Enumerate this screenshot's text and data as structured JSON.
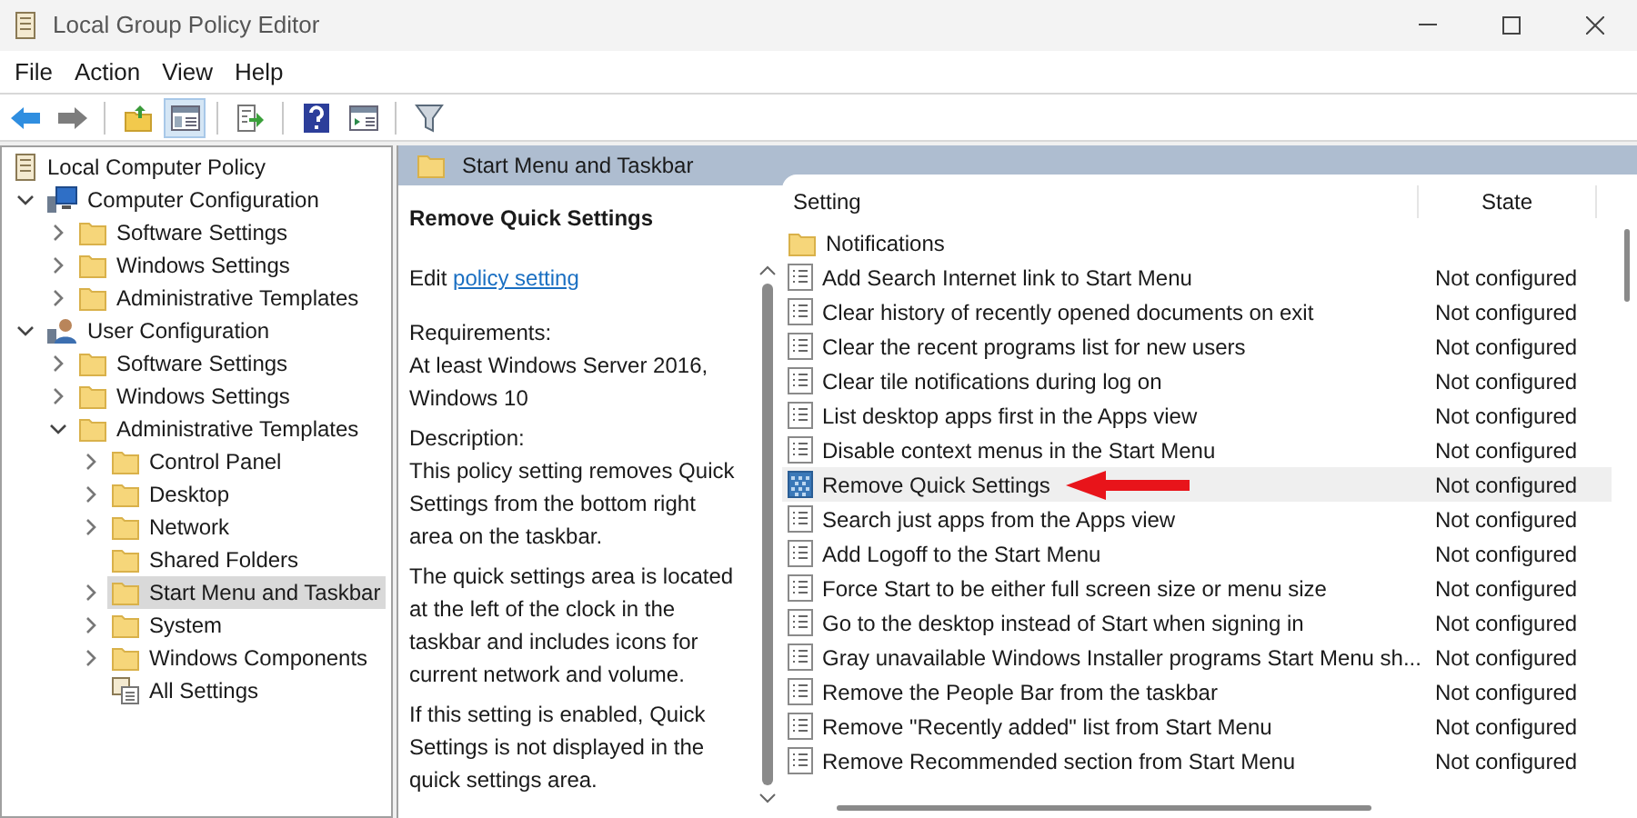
{
  "window": {
    "title": "Local Group Policy Editor"
  },
  "menu": [
    "File",
    "Action",
    "View",
    "Help"
  ],
  "toolbar": [
    {
      "kind": "back",
      "selected": false
    },
    {
      "kind": "forward",
      "selected": false
    },
    {
      "kind": "sep"
    },
    {
      "kind": "up",
      "selected": false
    },
    {
      "kind": "tree",
      "selected": true
    },
    {
      "kind": "sep"
    },
    {
      "kind": "export",
      "selected": false
    },
    {
      "kind": "sep"
    },
    {
      "kind": "help",
      "selected": false
    },
    {
      "kind": "view",
      "selected": false
    },
    {
      "kind": "sep"
    },
    {
      "kind": "filter",
      "selected": false
    }
  ],
  "tree": [
    {
      "label": "Local Computer Policy",
      "kind": "policy",
      "selected": false,
      "children": [
        {
          "label": "Computer Configuration",
          "kind": "computer",
          "expanded": true,
          "selected": false,
          "children": [
            {
              "label": "Software Settings",
              "kind": "folder",
              "expanded": false,
              "selected": false
            },
            {
              "label": "Windows Settings",
              "kind": "folder",
              "expanded": false,
              "selected": false
            },
            {
              "label": "Administrative Templates",
              "kind": "folder",
              "expanded": false,
              "selected": false
            }
          ]
        },
        {
          "label": "User Configuration",
          "kind": "user",
          "expanded": true,
          "selected": false,
          "children": [
            {
              "label": "Software Settings",
              "kind": "folder",
              "expanded": false,
              "selected": false
            },
            {
              "label": "Windows Settings",
              "kind": "folder",
              "expanded": false,
              "selected": false
            },
            {
              "label": "Administrative Templates",
              "kind": "folder",
              "expanded": true,
              "selected": false,
              "children": [
                {
                  "label": "Control Panel",
                  "kind": "folder",
                  "expanded": false,
                  "selected": false
                },
                {
                  "label": "Desktop",
                  "kind": "folder",
                  "expanded": false,
                  "selected": false
                },
                {
                  "label": "Network",
                  "kind": "folder",
                  "expanded": false,
                  "selected": false
                },
                {
                  "label": "Shared Folders",
                  "kind": "folder",
                  "selected": false
                },
                {
                  "label": "Start Menu and Taskbar",
                  "kind": "folder",
                  "expanded": false,
                  "selected": true
                },
                {
                  "label": "System",
                  "kind": "folder",
                  "expanded": false,
                  "selected": false
                },
                {
                  "label": "Windows Components",
                  "kind": "folder",
                  "expanded": false,
                  "selected": false
                },
                {
                  "label": "All Settings",
                  "kind": "all",
                  "selected": false
                }
              ]
            }
          ]
        }
      ]
    }
  ],
  "header": {
    "title": "Start Menu and Taskbar"
  },
  "description": {
    "title": "Remove Quick Settings",
    "edit_prefix": "Edit",
    "edit_link": "policy setting",
    "requirements_label": "Requirements:",
    "requirements": "At least Windows Server 2016, Windows 10",
    "description_label": "Description:",
    "paragraphs": [
      "This policy setting removes Quick Settings from the bottom right area on the taskbar.",
      "The quick settings area is located at the left of the clock in the taskbar and includes icons for current network and volume.",
      "If this setting is enabled, Quick Settings is not displayed in the quick settings area."
    ]
  },
  "table": {
    "columns": [
      "Setting",
      "State"
    ],
    "rows": [
      {
        "kind": "folder",
        "setting": "Notifications",
        "selected": false
      },
      {
        "kind": "policy",
        "setting": "Add Search Internet link to Start Menu",
        "state": "Not configured",
        "selected": false
      },
      {
        "kind": "policy",
        "setting": "Clear history of recently opened documents on exit",
        "state": "Not configured",
        "selected": false
      },
      {
        "kind": "policy",
        "setting": "Clear the recent programs list for new users",
        "state": "Not configured",
        "selected": false
      },
      {
        "kind": "policy",
        "setting": "Clear tile notifications during log on",
        "state": "Not configured",
        "selected": false
      },
      {
        "kind": "policy",
        "setting": "List desktop apps first in the Apps view",
        "state": "Not configured",
        "selected": false
      },
      {
        "kind": "policy",
        "setting": "Disable context menus in the Start Menu",
        "state": "Not configured",
        "selected": false
      },
      {
        "kind": "policy",
        "setting": "Remove Quick Settings",
        "state": "Not configured",
        "selected": true
      },
      {
        "kind": "policy",
        "setting": "Search just apps from the Apps view",
        "state": "Not configured",
        "selected": false
      },
      {
        "kind": "policy",
        "setting": "Add Logoff to the Start Menu",
        "state": "Not configured",
        "selected": false
      },
      {
        "kind": "policy",
        "setting": "Force Start to be either full screen size or menu size",
        "state": "Not configured",
        "selected": false
      },
      {
        "kind": "policy",
        "setting": "Go to the desktop instead of Start when signing in",
        "state": "Not configured",
        "selected": false
      },
      {
        "kind": "policy",
        "setting": "Gray unavailable Windows Installer programs Start Menu sh...",
        "state": "Not configured",
        "selected": false
      },
      {
        "kind": "policy",
        "setting": "Remove the People Bar from the taskbar",
        "state": "Not configured",
        "selected": false
      },
      {
        "kind": "policy",
        "setting": "Remove \"Recently added\" list from Start Menu",
        "state": "Not configured",
        "selected": false
      },
      {
        "kind": "policy",
        "setting": "Remove Recommended section from Start Menu",
        "state": "Not configured",
        "selected": false
      }
    ]
  }
}
